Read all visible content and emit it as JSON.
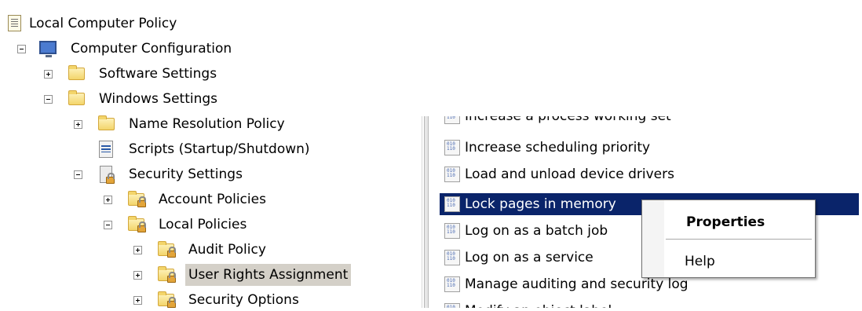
{
  "tree": {
    "root": "Local Computer Policy",
    "computer_configuration": "Computer Configuration",
    "software_settings": "Software Settings",
    "windows_settings": "Windows Settings",
    "name_resolution_policy": "Name Resolution Policy",
    "scripts": "Scripts (Startup/Shutdown)",
    "security_settings": "Security Settings",
    "account_policies": "Account Policies",
    "local_policies": "Local Policies",
    "audit_policy": "Audit Policy",
    "user_rights_assignment": "User Rights Assignment",
    "security_options": "Security Options"
  },
  "list": {
    "items": [
      "Increase a process working set",
      "Increase scheduling priority",
      "Load and unload device drivers",
      "Lock pages in memory",
      "Log on as a batch job",
      "Log on as a service",
      "Manage auditing and security log",
      "Modify an object label"
    ],
    "selected": "Lock pages in memory"
  },
  "context_menu": {
    "properties": "Properties",
    "help": "Help"
  },
  "colors": {
    "selection": "#0a246a",
    "tree_selection": "#d4d0c8"
  },
  "icons": {
    "root": "policy-document-icon",
    "computer": "computer-icon",
    "folder": "folder-icon",
    "secure_folder": "folder-lock-icon",
    "script": "script-icon",
    "security": "security-settings-icon",
    "policy_item": "policy-binary-icon"
  }
}
